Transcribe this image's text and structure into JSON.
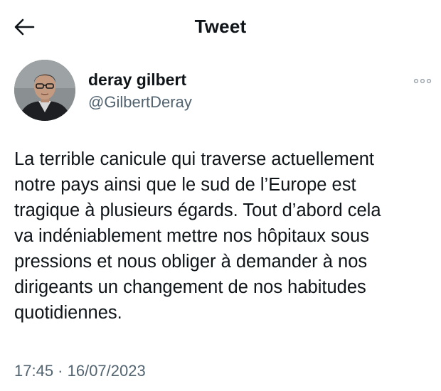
{
  "header": {
    "title": "Tweet",
    "back_icon": "arrow-left-icon"
  },
  "author": {
    "display_name": "deray gilbert",
    "handle": "@GilbertDeray",
    "avatar": "profile-photo",
    "more_icon": "more-horizontal-icon"
  },
  "tweet": {
    "text": "La terrible canicule qui traverse actuellement\nnotre pays ainsi que le sud de l’Europe est\ntragique à plusieurs égards. Tout d’abord cela\nva indéniablement mettre nos hôpitaux sous\npressions et nous obliger à demander à nos\ndirigeants un changement de nos habitudes\nquotidiennes.",
    "timestamp": "17:45 · 16/07/2023"
  },
  "colors": {
    "text": "#0f1419",
    "secondary": "#536471",
    "background": "#ffffff"
  }
}
